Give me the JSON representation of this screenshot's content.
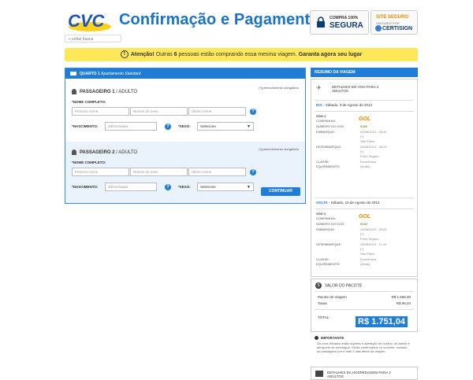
{
  "header": {
    "logo_text": "CVC",
    "title": "Confirmação e Pagamento",
    "back_link": "« voltar busca",
    "badge_secure": {
      "line1": "COMPRA 100%",
      "line2": "SEGURA"
    },
    "badge_cert": {
      "line1": "SITE SEGURO",
      "line2": "VALIDADO POR",
      "line3": "CERTISIGN"
    }
  },
  "attention": {
    "prefix": "Atenção!",
    "text1": " Outras ",
    "count": "6",
    "text2": " pessoas estão comprando essa mesma viagem. ",
    "cta": "Garanta agora seu lugar"
  },
  "room": {
    "label": "QUARTO 1",
    "type": "Apartamento Standard"
  },
  "passengers": [
    {
      "title": "PASSAGEIRO 1",
      "type": "ADULTO",
      "required_note": "(*)preenchimento obrigatório",
      "name_label": "*NOME COMPLETO:",
      "first_placeholder": "Primeiro nome",
      "middle_placeholder": "Nomes do meio",
      "last_placeholder": "Último nome",
      "birth_label": "*NASCIMENTO:",
      "birth_placeholder": "dd/mm/aaaa",
      "sex_label": "*SEXO:",
      "sex_value": "Selecione"
    },
    {
      "title": "PASSAGEIRO 2",
      "type": "ADULTO",
      "required_note": "(*)preenchimento obrigatório",
      "name_label": "*NOME COMPLETO:",
      "first_placeholder": "Primeiro nome",
      "middle_placeholder": "Nomes do meio",
      "last_placeholder": "Último nome",
      "birth_label": "*NASCIMENTO:",
      "birth_placeholder": "dd/mm/aaaa",
      "sex_label": "*SEXO:",
      "sex_value": "Selecione"
    }
  ],
  "continue_label": "CONTINUAR",
  "help_glyph": "?",
  "sidebar": {
    "head": "RESUMO DA VIAGEM",
    "flight_details": "DETALHES DO VOO PARA 2 ADULTOS",
    "legs": [
      {
        "dir": "IDA",
        "date": " - Sábado, 3 de Agosto de 2013",
        "voo": "VOO 1",
        "company_label": "COMPANHIA:",
        "company": "GOL",
        "flightno_label": "NÚMERO DO VOO:",
        "flightno": "9156",
        "emb_label": "EMBARQUE:",
        "emb_time": "03/08/2013 - 08:40",
        "emb_terminal": "(*)",
        "emb_city": "São Paulo",
        "des_label": "DESEMBARQUE:",
        "des_time": "03/08/2013 - 08:25",
        "des_terminal": "(*)",
        "des_city": "Porto Seguro",
        "class_label": "CLASSE:",
        "class": "Econômica",
        "equip_label": "EQUIPAMENTO:",
        "equip": "(Avião)"
      },
      {
        "dir": "VOLTA",
        "date": " - Sábado, 10 de Agosto de 2013",
        "voo": "VOO 1",
        "company_label": "COMPANHIA:",
        "company": "GOL",
        "flightno_label": "NÚMERO DO VOO:",
        "flightno": "9154",
        "emb_label": "EMBARQUE:",
        "emb_time": "10/08/2013 - 09:05",
        "emb_terminal": "(*)",
        "emb_city": "Porto Seguro",
        "des_label": "DESEMBARQUE:",
        "des_time": "10/08/2013 - 11:10",
        "des_terminal": "(*)",
        "des_city": "São Paulo",
        "class_label": "CLASSE:",
        "class": "Econômica",
        "equip_label": "EQUIPAMENTO:",
        "equip": "(Avião)"
      }
    ],
    "price_head": "VALOR DO PACOTE",
    "package_label": "Pacote de Viagem",
    "package_value": "R$ 1.656,00",
    "tax_label": "Taxas",
    "tax_value": "R$ 95,04",
    "total_label": "TOTAL:",
    "total_value": "R$ 1.751,04",
    "important_head": "IMPORTANTE",
    "important_text": "Os voos fretados estão sujeitos à alteração de horário, da adesa e aeroporto de embarque. Serão confirmados no voucher, enviado ao passageiro por e-mail 2 dias antes da viagem.",
    "lodging_head": "DETALHES DA HOSPEDAGEM PARA 2 ADULTOS"
  }
}
